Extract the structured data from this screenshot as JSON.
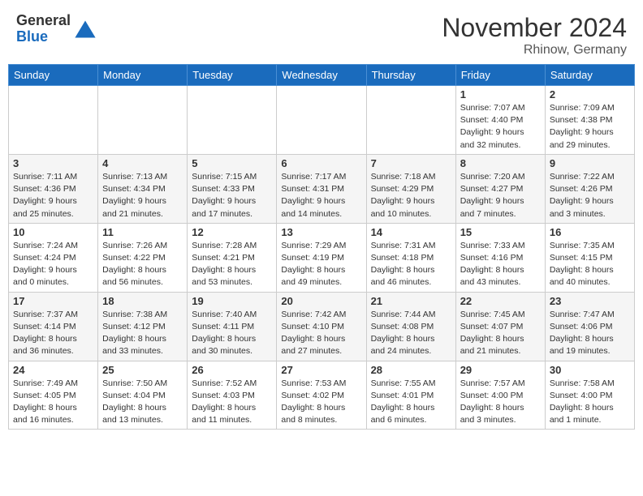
{
  "logo": {
    "general": "General",
    "blue": "Blue"
  },
  "title": "November 2024",
  "location": "Rhinow, Germany",
  "days_header": [
    "Sunday",
    "Monday",
    "Tuesday",
    "Wednesday",
    "Thursday",
    "Friday",
    "Saturday"
  ],
  "weeks": [
    [
      {
        "day": "",
        "info": ""
      },
      {
        "day": "",
        "info": ""
      },
      {
        "day": "",
        "info": ""
      },
      {
        "day": "",
        "info": ""
      },
      {
        "day": "",
        "info": ""
      },
      {
        "day": "1",
        "info": "Sunrise: 7:07 AM\nSunset: 4:40 PM\nDaylight: 9 hours and 32 minutes."
      },
      {
        "day": "2",
        "info": "Sunrise: 7:09 AM\nSunset: 4:38 PM\nDaylight: 9 hours and 29 minutes."
      }
    ],
    [
      {
        "day": "3",
        "info": "Sunrise: 7:11 AM\nSunset: 4:36 PM\nDaylight: 9 hours and 25 minutes."
      },
      {
        "day": "4",
        "info": "Sunrise: 7:13 AM\nSunset: 4:34 PM\nDaylight: 9 hours and 21 minutes."
      },
      {
        "day": "5",
        "info": "Sunrise: 7:15 AM\nSunset: 4:33 PM\nDaylight: 9 hours and 17 minutes."
      },
      {
        "day": "6",
        "info": "Sunrise: 7:17 AM\nSunset: 4:31 PM\nDaylight: 9 hours and 14 minutes."
      },
      {
        "day": "7",
        "info": "Sunrise: 7:18 AM\nSunset: 4:29 PM\nDaylight: 9 hours and 10 minutes."
      },
      {
        "day": "8",
        "info": "Sunrise: 7:20 AM\nSunset: 4:27 PM\nDaylight: 9 hours and 7 minutes."
      },
      {
        "day": "9",
        "info": "Sunrise: 7:22 AM\nSunset: 4:26 PM\nDaylight: 9 hours and 3 minutes."
      }
    ],
    [
      {
        "day": "10",
        "info": "Sunrise: 7:24 AM\nSunset: 4:24 PM\nDaylight: 9 hours and 0 minutes."
      },
      {
        "day": "11",
        "info": "Sunrise: 7:26 AM\nSunset: 4:22 PM\nDaylight: 8 hours and 56 minutes."
      },
      {
        "day": "12",
        "info": "Sunrise: 7:28 AM\nSunset: 4:21 PM\nDaylight: 8 hours and 53 minutes."
      },
      {
        "day": "13",
        "info": "Sunrise: 7:29 AM\nSunset: 4:19 PM\nDaylight: 8 hours and 49 minutes."
      },
      {
        "day": "14",
        "info": "Sunrise: 7:31 AM\nSunset: 4:18 PM\nDaylight: 8 hours and 46 minutes."
      },
      {
        "day": "15",
        "info": "Sunrise: 7:33 AM\nSunset: 4:16 PM\nDaylight: 8 hours and 43 minutes."
      },
      {
        "day": "16",
        "info": "Sunrise: 7:35 AM\nSunset: 4:15 PM\nDaylight: 8 hours and 40 minutes."
      }
    ],
    [
      {
        "day": "17",
        "info": "Sunrise: 7:37 AM\nSunset: 4:14 PM\nDaylight: 8 hours and 36 minutes."
      },
      {
        "day": "18",
        "info": "Sunrise: 7:38 AM\nSunset: 4:12 PM\nDaylight: 8 hours and 33 minutes."
      },
      {
        "day": "19",
        "info": "Sunrise: 7:40 AM\nSunset: 4:11 PM\nDaylight: 8 hours and 30 minutes."
      },
      {
        "day": "20",
        "info": "Sunrise: 7:42 AM\nSunset: 4:10 PM\nDaylight: 8 hours and 27 minutes."
      },
      {
        "day": "21",
        "info": "Sunrise: 7:44 AM\nSunset: 4:08 PM\nDaylight: 8 hours and 24 minutes."
      },
      {
        "day": "22",
        "info": "Sunrise: 7:45 AM\nSunset: 4:07 PM\nDaylight: 8 hours and 21 minutes."
      },
      {
        "day": "23",
        "info": "Sunrise: 7:47 AM\nSunset: 4:06 PM\nDaylight: 8 hours and 19 minutes."
      }
    ],
    [
      {
        "day": "24",
        "info": "Sunrise: 7:49 AM\nSunset: 4:05 PM\nDaylight: 8 hours and 16 minutes."
      },
      {
        "day": "25",
        "info": "Sunrise: 7:50 AM\nSunset: 4:04 PM\nDaylight: 8 hours and 13 minutes."
      },
      {
        "day": "26",
        "info": "Sunrise: 7:52 AM\nSunset: 4:03 PM\nDaylight: 8 hours and 11 minutes."
      },
      {
        "day": "27",
        "info": "Sunrise: 7:53 AM\nSunset: 4:02 PM\nDaylight: 8 hours and 8 minutes."
      },
      {
        "day": "28",
        "info": "Sunrise: 7:55 AM\nSunset: 4:01 PM\nDaylight: 8 hours and 6 minutes."
      },
      {
        "day": "29",
        "info": "Sunrise: 7:57 AM\nSunset: 4:00 PM\nDaylight: 8 hours and 3 minutes."
      },
      {
        "day": "30",
        "info": "Sunrise: 7:58 AM\nSunset: 4:00 PM\nDaylight: 8 hours and 1 minute."
      }
    ]
  ]
}
